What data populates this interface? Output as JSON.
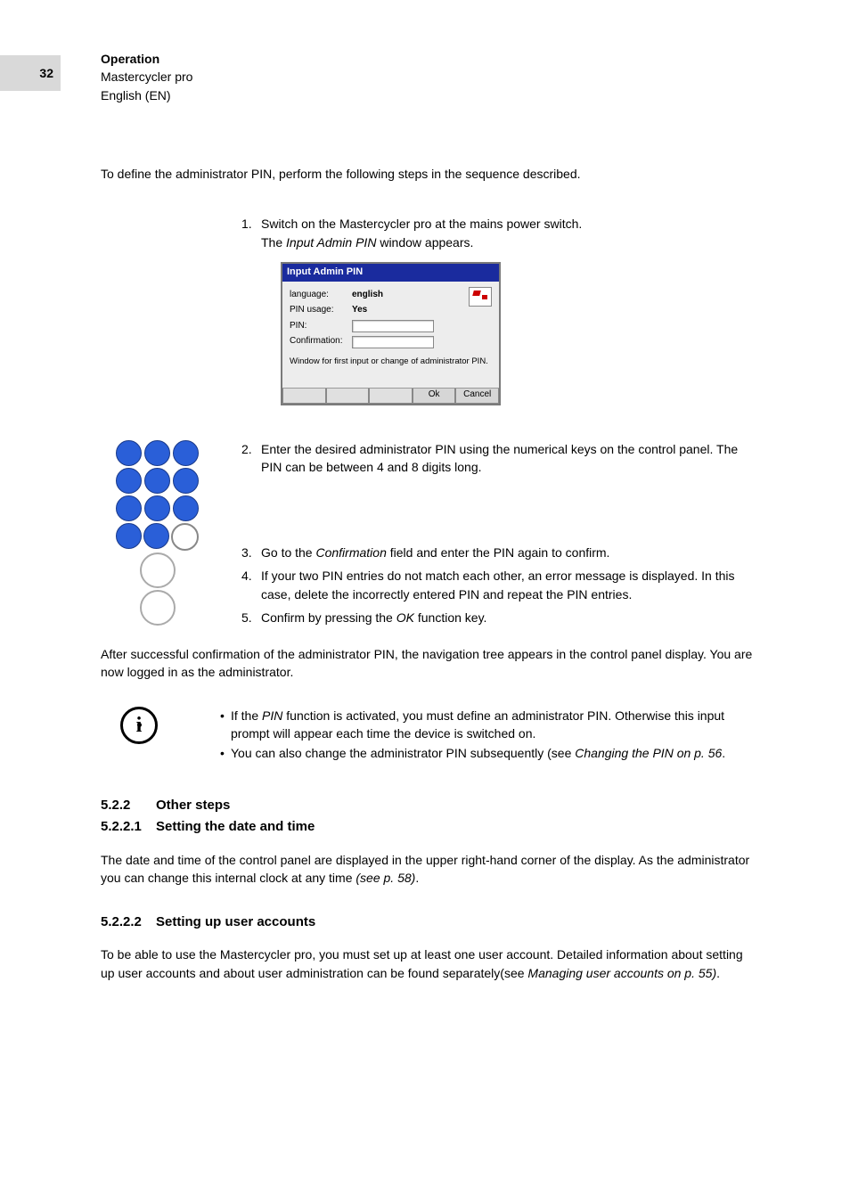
{
  "pageNumber": "32",
  "header": {
    "l1": "Operation",
    "l2": "Mastercycler pro",
    "l3": "English (EN)"
  },
  "intro": "To define the administrator PIN, perform the following steps in the sequence described.",
  "steps": {
    "s1n": "1.",
    "s1a": "Switch on the Mastercycler pro at the mains power switch.",
    "s1b_pre": "The ",
    "s1b_em": "Input Admin PIN",
    "s1b_post": " window appears.",
    "s2n": "2.",
    "s2": "Enter the desired administrator PIN using the numerical keys on the control panel. The PIN can be between 4 and 8 digits long.",
    "s3n": "3.",
    "s3_pre": "Go to the ",
    "s3_em": "Confirmation",
    "s3_post": " field and enter the PIN again to confirm.",
    "s4n": "4.",
    "s4": "If your two PIN entries do not match each other, an error message is displayed. In this case, delete the incorrectly entered PIN and repeat the PIN entries.",
    "s5n": "5.",
    "s5_pre": "Confirm by pressing the ",
    "s5_em": "OK",
    "s5_post": " function key."
  },
  "win": {
    "title": "Input Admin PIN",
    "langLabel": "language:",
    "langVal": "english",
    "pinUsageLabel": "PIN usage:",
    "pinUsageVal": "Yes",
    "pinLabel": "PIN:",
    "confLabel": "Confirmation:",
    "hint": "Window for first input or change of administrator PIN.",
    "ok": "Ok",
    "cancel": "Cancel"
  },
  "after": "After successful confirmation of the administrator PIN, the navigation tree appears in the control panel display. You are now logged in as the administrator.",
  "info": {
    "i1_pre": "If the ",
    "i1_em": "PIN",
    "i1_post": " function is activated, you must define an administrator PIN. Otherwise this input prompt will appear each time the device is switched on.",
    "i2_pre": "You can also change the administrator PIN subsequently (see ",
    "i2_em": "Changing the PIN on p. 56",
    "i2_post": "."
  },
  "s522n": "5.2.2",
  "s522": "Other steps",
  "s5221n": "5.2.2.1",
  "s5221": "Setting the date and time",
  "p5221_pre": "The date and time of the control panel are displayed in the upper right-hand corner of the display. As the administrator you can change this internal clock at any time ",
  "p5221_em": "(see p. 58)",
  "p5221_post": ".",
  "s5222n": "5.2.2.2",
  "s5222": "Setting up user accounts",
  "p5222_pre": "To be able to use the Mastercycler pro, you must set up at least one user account. Detailed information about setting up user accounts and about user administration can be found separately(see ",
  "p5222_em": "Managing user accounts on p. 55)",
  "p5222_post": "."
}
